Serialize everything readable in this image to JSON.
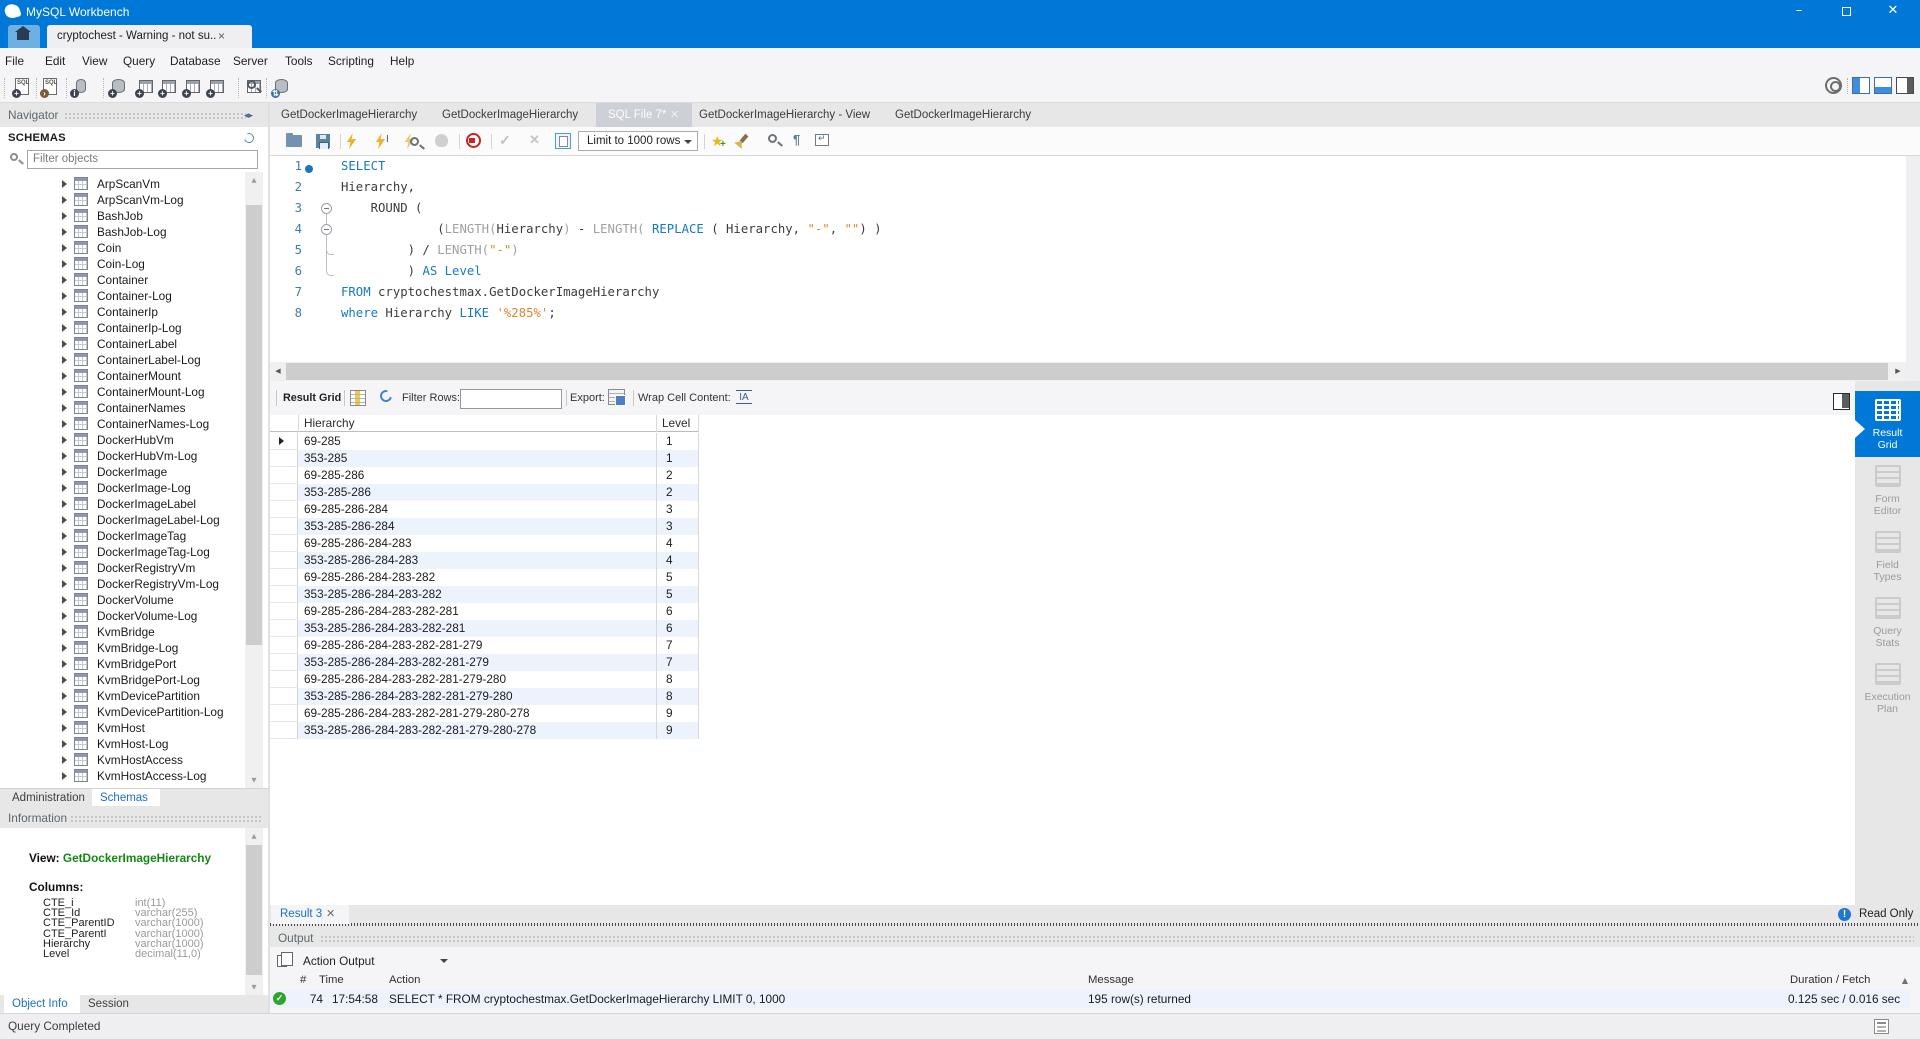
{
  "window": {
    "title": "MySQL Workbench",
    "doc_tab": "cryptochest - Warning - not su...",
    "close_glyph": "×"
  },
  "menu": {
    "items": [
      "File",
      "Edit",
      "View",
      "Query",
      "Database",
      "Server",
      "Tools",
      "Scripting",
      "Help"
    ]
  },
  "editor_tabs": [
    {
      "label": "GetDockerImageHierarchy",
      "active": false
    },
    {
      "label": "GetDockerImageHierarchy",
      "active": false
    },
    {
      "label": "SQL File 7*",
      "active": true
    },
    {
      "label": "GetDockerImageHierarchy - View",
      "active": false
    },
    {
      "label": "GetDockerImageHierarchy",
      "active": false
    }
  ],
  "sql_toolbar": {
    "limit_value": "Limit to 1000 rows"
  },
  "code": {
    "lines": [
      {
        "n": "1",
        "tokens": [
          [
            "kw",
            "SELECT"
          ]
        ]
      },
      {
        "n": "2",
        "tokens": [
          [
            "pl",
            "Hierarchy,"
          ]
        ]
      },
      {
        "n": "3",
        "tokens": [
          [
            "pl",
            "    ROUND ("
          ]
        ]
      },
      {
        "n": "4",
        "tokens": [
          [
            "pl",
            "             ("
          ],
          [
            "fn",
            "LENGTH("
          ],
          [
            "pl",
            "Hierarchy"
          ],
          [
            "fn",
            ")"
          ],
          [
            "pl",
            " - "
          ],
          [
            "fn",
            "LENGTH( "
          ],
          [
            "kw",
            "REPLACE"
          ],
          [
            "pl",
            " ( Hierarchy, "
          ],
          [
            "str",
            "\"-\""
          ],
          [
            "pl",
            ", "
          ],
          [
            "str",
            "\"\""
          ],
          [
            "pl",
            ") )"
          ]
        ]
      },
      {
        "n": "5",
        "tokens": [
          [
            "pl",
            "         ) / "
          ],
          [
            "fn",
            "LENGTH("
          ],
          [
            "str",
            "\"-\""
          ],
          [
            "fn",
            ")"
          ]
        ]
      },
      {
        "n": "6",
        "tokens": [
          [
            "pl",
            "         ) "
          ],
          [
            "kw",
            "AS"
          ],
          [
            "pl",
            " "
          ],
          [
            "kw",
            "Level"
          ]
        ]
      },
      {
        "n": "7",
        "tokens": [
          [
            "kw",
            "FROM"
          ],
          [
            "pl",
            " cryptochestmax.GetDockerImageHierarchy"
          ]
        ]
      },
      {
        "n": "8",
        "tokens": [
          [
            "kw",
            "where"
          ],
          [
            "pl",
            " Hierarchy "
          ],
          [
            "kw",
            "LIKE"
          ],
          [
            "pl",
            " "
          ],
          [
            "str",
            "'%285%'"
          ],
          [
            "pl",
            ";"
          ]
        ]
      }
    ]
  },
  "navigator": {
    "header": "Navigator",
    "schemas_title": "SCHEMAS",
    "filter_placeholder": "Filter objects",
    "tree": [
      "ArpScanVm",
      "ArpScanVm-Log",
      "BashJob",
      "BashJob-Log",
      "Coin",
      "Coin-Log",
      "Container",
      "Container-Log",
      "ContainerIp",
      "ContainerIp-Log",
      "ContainerLabel",
      "ContainerLabel-Log",
      "ContainerMount",
      "ContainerMount-Log",
      "ContainerNames",
      "ContainerNames-Log",
      "DockerHubVm",
      "DockerHubVm-Log",
      "DockerImage",
      "DockerImage-Log",
      "DockerImageLabel",
      "DockerImageLabel-Log",
      "DockerImageTag",
      "DockerImageTag-Log",
      "DockerRegistryVm",
      "DockerRegistryVm-Log",
      "DockerVolume",
      "DockerVolume-Log",
      "KvmBridge",
      "KvmBridge-Log",
      "KvmBridgePort",
      "KvmBridgePort-Log",
      "KvmDevicePartition",
      "KvmDevicePartition-Log",
      "KvmHost",
      "KvmHost-Log",
      "KvmHostAccess",
      "KvmHostAccess-Log"
    ],
    "bottom_tabs": [
      "Administration",
      "Schemas"
    ]
  },
  "information": {
    "header": "Information",
    "view_label": "View:",
    "view_name": "GetDockerImageHierarchy",
    "columns_label": "Columns:",
    "columns": [
      {
        "name": "CTE_i",
        "type": "int(11)"
      },
      {
        "name": "CTE_Id",
        "type": "varchar(255)"
      },
      {
        "name": "CTE_ParentID",
        "type": "varchar(1000)"
      },
      {
        "name": "CTE_ParentI",
        "type": "varchar(1000)"
      },
      {
        "name": "Hierarchy",
        "type": "varchar(1000)"
      },
      {
        "name": "Level",
        "type": "decimal(11,0)"
      }
    ],
    "bottom_tabs": [
      "Object Info",
      "Session"
    ]
  },
  "result_toolbar": {
    "title": "Result Grid",
    "filter_label": "Filter Rows:",
    "export_label": "Export:",
    "wrap_label": "Wrap Cell Content:"
  },
  "result_grid": {
    "columns": [
      "Hierarchy",
      "Level"
    ],
    "rows": [
      [
        "69-285",
        "1"
      ],
      [
        "353-285",
        "1"
      ],
      [
        "69-285-286",
        "2"
      ],
      [
        "353-285-286",
        "2"
      ],
      [
        "69-285-286-284",
        "3"
      ],
      [
        "353-285-286-284",
        "3"
      ],
      [
        "69-285-286-284-283",
        "4"
      ],
      [
        "353-285-286-284-283",
        "4"
      ],
      [
        "69-285-286-284-283-282",
        "5"
      ],
      [
        "353-285-286-284-283-282",
        "5"
      ],
      [
        "69-285-286-284-283-282-281",
        "6"
      ],
      [
        "353-285-286-284-283-282-281",
        "6"
      ],
      [
        "69-285-286-284-283-282-281-279",
        "7"
      ],
      [
        "353-285-286-284-283-282-281-279",
        "7"
      ],
      [
        "69-285-286-284-283-282-281-279-280",
        "8"
      ],
      [
        "353-285-286-284-283-282-281-279-280",
        "8"
      ],
      [
        "69-285-286-284-283-282-281-279-280-278",
        "9"
      ],
      [
        "353-285-286-284-283-282-281-279-280-278",
        "9"
      ]
    ]
  },
  "sidebar": {
    "items": [
      {
        "line1": "Result",
        "line2": "Grid",
        "active": true
      },
      {
        "line1": "Form",
        "line2": "Editor",
        "active": false
      },
      {
        "line1": "Field",
        "line2": "Types",
        "active": false
      },
      {
        "line1": "Query",
        "line2": "Stats",
        "active": false
      },
      {
        "line1": "Execution",
        "line2": "Plan",
        "active": false
      }
    ]
  },
  "result_tab": {
    "label": "Result 3",
    "read_only": "Read Only"
  },
  "output": {
    "header": "Output",
    "mode": "Action Output",
    "columns": [
      "#",
      "Time",
      "Action",
      "Message",
      "Duration / Fetch"
    ],
    "row": {
      "index": "74",
      "time": "17:54:58",
      "action": "SELECT * FROM cryptochestmax.GetDockerImageHierarchy LIMIT 0, 1000",
      "message": "195 row(s) returned",
      "duration": "0.125 sec / 0.016 sec"
    }
  },
  "statusbar": {
    "text": "Query Completed"
  }
}
